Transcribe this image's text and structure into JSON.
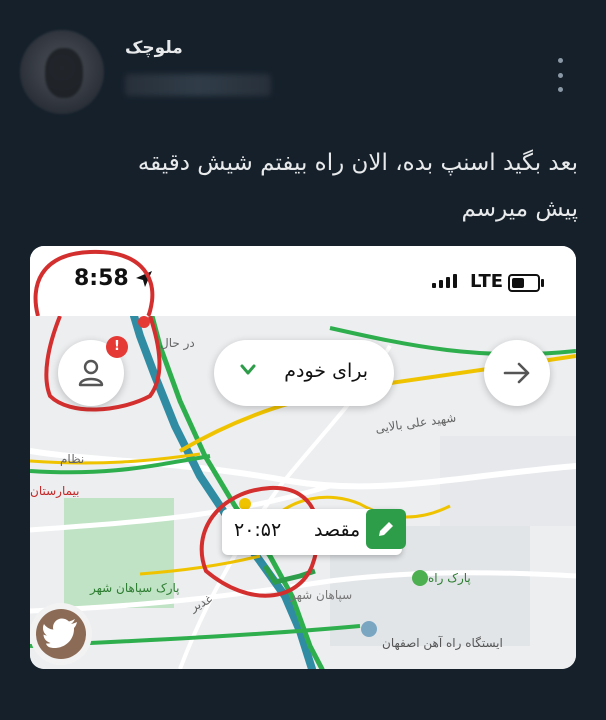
{
  "post": {
    "author_name": "ملوچک",
    "text_line1": "بعد بگید اسنپ بده، الان راه بیفتم شیش دقیقه",
    "text_line2": "پیش میرسم"
  },
  "phone_screenshot": {
    "status_bar": {
      "time": "8:58",
      "network": "LTE"
    },
    "map_buttons": {
      "ride_for_label": "برای خودم",
      "notification_count": "!"
    },
    "destination": {
      "label": "مقصد",
      "arrival_time": "۲۰:۵۲"
    },
    "map_labels": {
      "street_1": "شهید علی بالایی",
      "street_2": "نظام",
      "hospital": "بیمارستان",
      "park_1": "پارک راه",
      "park_2": "پارک سپاهان شهر",
      "station": "ایستگاه راه آهن اصفهان",
      "street_3": "غدیر",
      "street_4": "در حال",
      "street_5": "سپاهان شهر"
    }
  },
  "colors": {
    "background": "#15202b",
    "annotation_red": "#d32f2f",
    "route_green": "#2e9d4a"
  }
}
